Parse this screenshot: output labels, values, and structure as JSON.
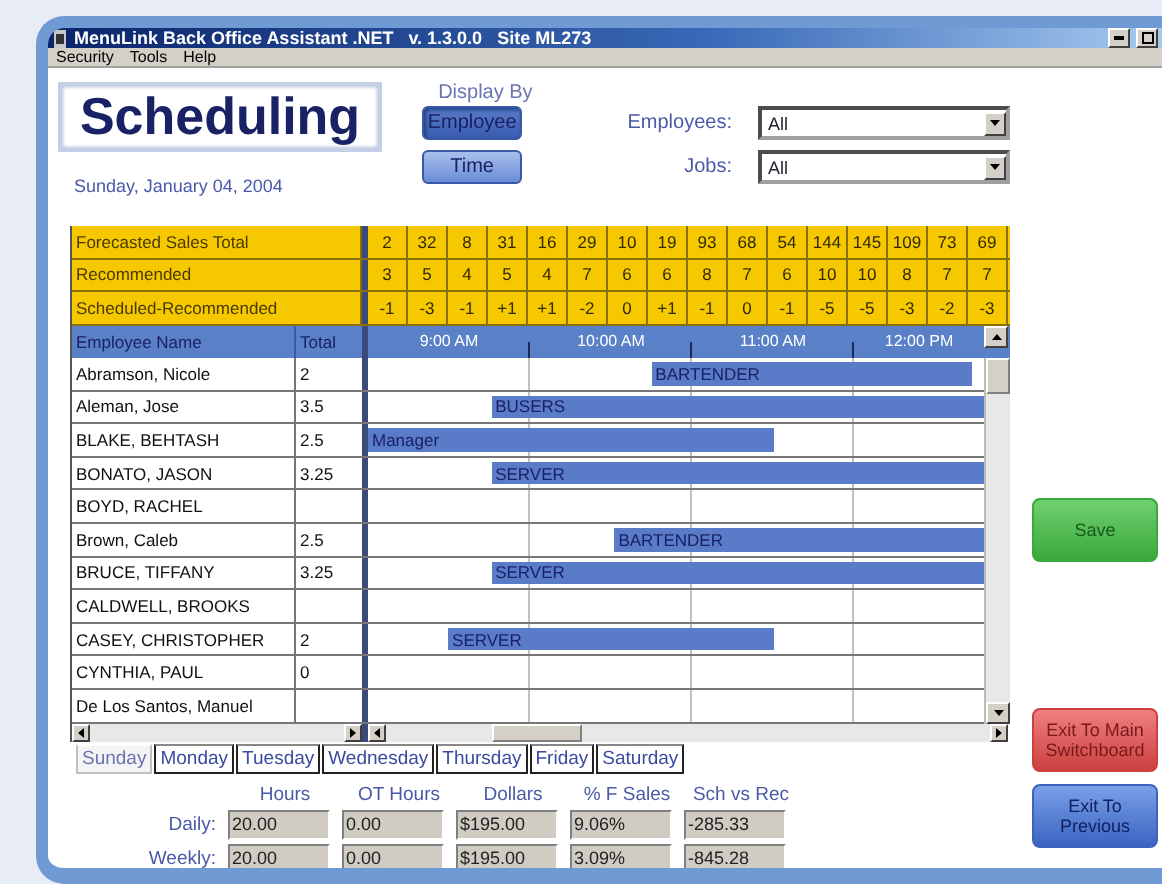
{
  "window": {
    "title": "MenuLink Back Office Assistant .NET   v. 1.3.0.0   Site ML273"
  },
  "menu": [
    "Security",
    "Tools",
    "Help"
  ],
  "header": {
    "title": "Scheduling",
    "date": "Sunday, January 04, 2004"
  },
  "display_by": {
    "label": "Display By",
    "options": [
      {
        "label": "Employee",
        "selected": true
      },
      {
        "label": "Time",
        "selected": false
      }
    ]
  },
  "filters": [
    {
      "label": "Employees:",
      "value": "All"
    },
    {
      "label": "Jobs:",
      "value": "All"
    }
  ],
  "summary_rows": [
    {
      "label": "Forecasted Sales Total",
      "values": [
        "2",
        "32",
        "8",
        "31",
        "16",
        "29",
        "10",
        "19",
        "93",
        "68",
        "54",
        "144",
        "145",
        "109",
        "73",
        "69"
      ]
    },
    {
      "label": "Recommended",
      "values": [
        "3",
        "5",
        "4",
        "5",
        "4",
        "7",
        "6",
        "6",
        "8",
        "7",
        "6",
        "10",
        "10",
        "8",
        "7",
        "7"
      ]
    },
    {
      "label": "Scheduled-Recommended",
      "values": [
        "-1",
        "-3",
        "-1",
        "+1",
        "+1",
        "-2",
        "0",
        "+1",
        "-1",
        "0",
        "-1",
        "-5",
        "-5",
        "-3",
        "-2",
        "-3"
      ]
    }
  ],
  "grid": {
    "columns": [
      "Employee Name",
      "Total"
    ],
    "times": [
      "9:00 AM",
      "10:00 AM",
      "11:00 AM",
      "12:00 PM"
    ],
    "rows": [
      {
        "name": "Abramson, Nicole",
        "total": "2",
        "shift": {
          "label": "BARTENDER"
        }
      },
      {
        "name": "Aleman, Jose",
        "total": "3.5",
        "shift": {
          "label": "BUSERS"
        }
      },
      {
        "name": "BLAKE, BEHTASH",
        "total": "2.5",
        "shift": {
          "label": "Manager"
        }
      },
      {
        "name": "BONATO, JASON",
        "total": "3.25",
        "shift": {
          "label": "SERVER"
        }
      },
      {
        "name": "BOYD, RACHEL"
      },
      {
        "name": "Brown, Caleb",
        "total": "2.5",
        "shift": {
          "label": "BARTENDER"
        }
      },
      {
        "name": "BRUCE, TIFFANY",
        "total": "3.25",
        "shift": {
          "label": "SERVER"
        }
      },
      {
        "name": "CALDWELL, BROOKS"
      },
      {
        "name": "CASEY, CHRISTOPHER",
        "total": "2",
        "shift": {
          "label": "SERVER"
        }
      },
      {
        "name": "CYNTHIA, PAUL",
        "total": "0"
      },
      {
        "name": "De Los Santos, Manuel"
      }
    ]
  },
  "day_tabs": [
    {
      "label": "Sunday",
      "selected": true
    },
    {
      "label": "Monday",
      "selected": false
    },
    {
      "label": "Tuesday",
      "selected": false
    },
    {
      "label": "Wednesday",
      "selected": false
    },
    {
      "label": "Thursday",
      "selected": false
    },
    {
      "label": "Friday",
      "selected": false
    },
    {
      "label": "Saturday",
      "selected": false
    }
  ],
  "totals": {
    "columns": [
      "Hours",
      "OT Hours",
      "Dollars",
      "% F Sales",
      "Sch vs Rec"
    ],
    "rows": [
      {
        "label": "Daily:",
        "values": [
          "20.00",
          "0.00",
          "$195.00",
          "9.06%",
          "-285.33"
        ]
      },
      {
        "label": "Weekly:",
        "values": [
          "20.00",
          "0.00",
          "$195.00",
          "3.09%",
          "-845.28"
        ]
      }
    ]
  },
  "buttons": [
    {
      "label": "Save",
      "kind": "save"
    },
    {
      "label": "Exit To Main Switchboard",
      "kind": "exit"
    },
    {
      "label": "Exit To Previous",
      "kind": "back"
    }
  ]
}
